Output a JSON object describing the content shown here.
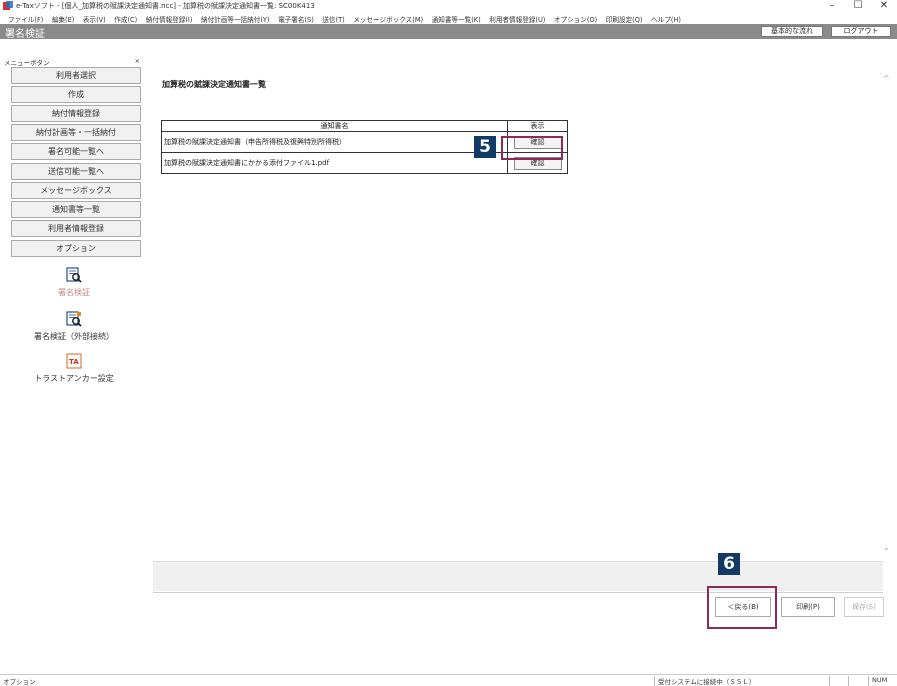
{
  "window": {
    "title": "e-Taxソフト - [個人_加算税の賦課決定通知書.ncc] - 加算税の賦課決定通知書一覧: SC00K413",
    "minimize_glyph": "–",
    "maximize_glyph": "☐",
    "close_glyph": "✕"
  },
  "menubar": [
    "ファイル(F)",
    "編集(E)",
    "表示(V)",
    "作成(C)",
    "納付情報登録(I)",
    "納付計画等一括納付(Y)",
    "電子署名(S)",
    "送信(T)",
    "メッセージボックス(M)",
    "通知書等一覧(K)",
    "利用者情報登録(U)",
    "オプション(O)",
    "印刷設定(Q)",
    "ヘルプ(H)"
  ],
  "header": {
    "title": "署名検証",
    "basic_flow_button": "基本的な流れ",
    "logout_button": "ログアウト"
  },
  "sidebar": {
    "menu_header": "メニューボタン",
    "close_glyph": "×",
    "buttons": [
      "利用者選択",
      "作成",
      "納付情報登録",
      "納付計画等・一括納付",
      "署名可能一覧へ",
      "送信可能一覧へ",
      "メッセージボックス",
      "通知書等一覧",
      "利用者情報登録",
      "オプション"
    ],
    "tools": [
      {
        "label": "署名検証",
        "icon": "signature-verify-icon"
      },
      {
        "label": "署名検証（外部接続）",
        "icon": "signature-verify-external-icon"
      },
      {
        "label": "トラストアンカー設定",
        "icon": "trust-anchor-icon",
        "icon_text": "TA"
      }
    ]
  },
  "main": {
    "heading": "加算税の賦課決定通知書一覧",
    "table": {
      "col_name": "通知書名",
      "col_action": "表示",
      "rows": [
        {
          "name": "加算税の賦課決定通知書（申告所得税及復興特別所得税）",
          "action": "確認"
        },
        {
          "name": "加算税の賦課決定通知書にかかる添付ファイル1.pdf",
          "action": "確認"
        }
      ]
    },
    "step_markers": [
      "5",
      "6"
    ]
  },
  "bottom": {
    "back_button": "＜戻る(B)",
    "print_button": "印刷(P)",
    "save_button": "保存(S)"
  },
  "statusbar": {
    "left": "オプション",
    "connection": "受付システムに接続中（ＳＳＬ）",
    "cell_empty": "",
    "num": "NUM"
  },
  "colors": {
    "header_gray": "#8a8a8a",
    "marker_navy": "#123a66",
    "highlight_magenta": "#8c2a5a"
  }
}
